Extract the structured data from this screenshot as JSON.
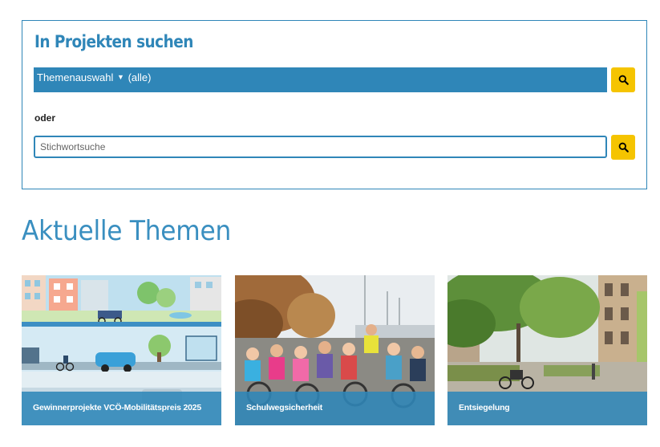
{
  "search": {
    "title": "In Projekten suchen",
    "theme_select": {
      "label": "Themenauswahl",
      "value": "(alle)"
    },
    "or_label": "oder",
    "keyword_placeholder": "Stichwortsuche"
  },
  "themes": {
    "title": "Aktuelle Themen",
    "cards": [
      {
        "label": "Gewinnerprojekte VCÖ-Mobilitätspreis 2025"
      },
      {
        "label": "Schulwegsicherheit"
      },
      {
        "label": "Entsiegelung"
      }
    ]
  },
  "colors": {
    "accent": "#2f86b8",
    "button": "#f5c400"
  }
}
